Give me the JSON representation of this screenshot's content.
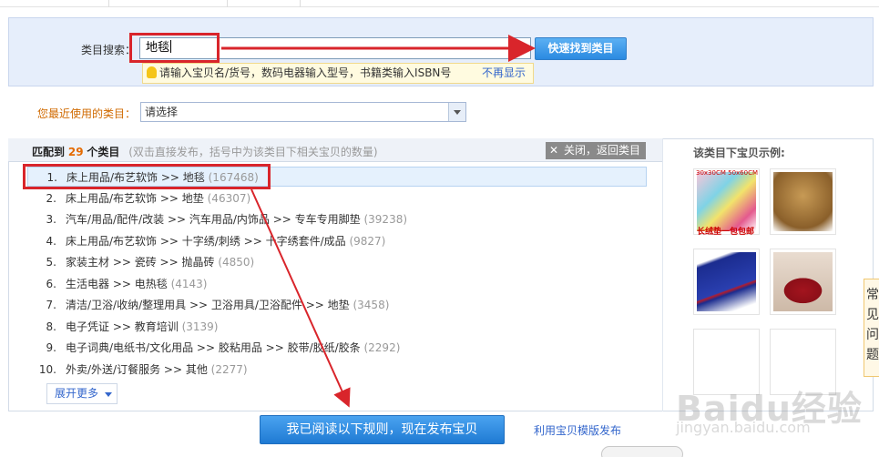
{
  "search": {
    "label": "类目搜索：",
    "value": "地毯",
    "find_button": "快速找到类目",
    "tip": "请输入宝贝名/货号，数码电器输入型号，书籍类输入ISBN号",
    "tip_hide": "不再显示"
  },
  "recent": {
    "label": "您最近使用的类目：",
    "selected": "请选择"
  },
  "results": {
    "match_prefix": "匹配到",
    "count": "29",
    "count_suffix": "个类目",
    "hint": "(双击直接发布，括号中为该类目下相关宝贝的数量)",
    "close_label": "关闭，返回类目",
    "items": [
      {
        "num": "1.",
        "path": "床上用品/布艺软饰 >> 地毯",
        "count": "(167468)"
      },
      {
        "num": "2.",
        "path": "床上用品/布艺软饰 >> 地垫",
        "count": "(46307)"
      },
      {
        "num": "3.",
        "path": "汽车/用品/配件/改装 >> 汽车用品/内饰品 >> 专车专用脚垫",
        "count": "(39238)"
      },
      {
        "num": "4.",
        "path": "床上用品/布艺软饰 >> 十字绣/刺绣 >> 十字绣套件/成品",
        "count": "(9827)"
      },
      {
        "num": "5.",
        "path": "家装主材 >> 瓷砖 >> 抛晶砖",
        "count": "(4850)"
      },
      {
        "num": "6.",
        "path": "生活电器 >> 电热毯",
        "count": "(4143)"
      },
      {
        "num": "7.",
        "path": "清洁/卫浴/收纳/整理用具 >> 卫浴用具/卫浴配件 >> 地垫",
        "count": "(3458)"
      },
      {
        "num": "8.",
        "path": "电子凭证 >> 教育培训",
        "count": "(3139)"
      },
      {
        "num": "9.",
        "path": "电子词典/电纸书/文化用品 >> 胶粘用品 >> 胶带/胶纸/胶条",
        "count": "(2292)"
      },
      {
        "num": "10.",
        "path": "外卖/外送/订餐服务 >> 其他",
        "count": "(2277)"
      }
    ],
    "expand_label": "展开更多"
  },
  "examples": {
    "title": "该类目下宝贝示例:",
    "thumb1_caption_top": "30x30CM 50x60CM",
    "thumb1_caption_bottom": "长绒垫一包包邮"
  },
  "footer": {
    "publish_button": "我已阅读以下规则，现在发布宝贝",
    "template_link": "利用宝贝模版发布"
  },
  "side_tab": {
    "text": "常见问题"
  },
  "watermark": {
    "line1": "Baidu经验",
    "line2": "jingyan.baidu.com"
  },
  "colors": {
    "annotation_red": "#d9252b",
    "accent_blue": "#2b8ae1",
    "count_orange": "#e46a00"
  }
}
